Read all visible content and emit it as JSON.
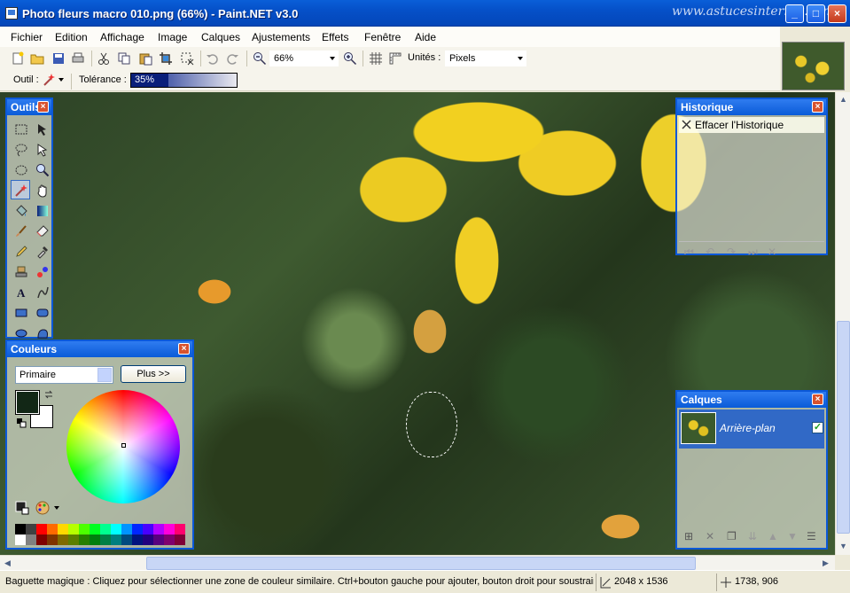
{
  "window": {
    "title": "Photo fleurs macro 010.png (66%) - Paint.NET v3.0",
    "watermark": "www.astucesinternet.com"
  },
  "menu": [
    "Fichier",
    "Edition",
    "Affichage",
    "Image",
    "Calques",
    "Ajustements",
    "Effets",
    "Fenêtre",
    "Aide"
  ],
  "toolbar": {
    "zoom_value": "66%",
    "units_label": "Unités :",
    "units_value": "Pixels"
  },
  "tool_options": {
    "tool_label": "Outil :",
    "tolerance_label": "Tolérance :",
    "tolerance_value": "35%",
    "tolerance_level": 0.35
  },
  "tools_panel": {
    "title": "Outils",
    "selected": "magic-wand"
  },
  "history_panel": {
    "title": "Historique",
    "items": [
      "Effacer l'Historique"
    ]
  },
  "layers_panel": {
    "title": "Calques",
    "layers": [
      {
        "name": "Arrière-plan",
        "visible": true
      }
    ]
  },
  "colors_panel": {
    "title": "Couleurs",
    "mode": "Primaire",
    "more_button": "Plus >>",
    "primary_color": "#122716",
    "secondary_color": "#ffffff"
  },
  "status": {
    "hint": "Baguette magique : Cliquez pour sélectionner une zone de couleur similaire. Ctrl+bouton gauche pour ajouter, bouton droit pour soustraire.",
    "image_size": "2048 x 1536",
    "cursor_pos": "1738, 906"
  },
  "colors": {
    "title_bar": "#0550c8",
    "panel_border": "#0b58d8",
    "selection_fill": "#3169c6"
  },
  "palette": [
    "#000000",
    "#404040",
    "#ff0000",
    "#ff6a00",
    "#ffd800",
    "#b6ff00",
    "#4cff00",
    "#00ff21",
    "#00ff90",
    "#00ffff",
    "#0094ff",
    "#0026ff",
    "#4800ff",
    "#b200ff",
    "#ff00dc",
    "#ff006e",
    "#ffffff",
    "#808080",
    "#7f0000",
    "#7f3300",
    "#7f6a00",
    "#5b7f00",
    "#267f00",
    "#007f0e",
    "#007f46",
    "#007f7f",
    "#004a7f",
    "#00137f",
    "#21007f",
    "#57007f",
    "#7f006e",
    "#7f0037"
  ]
}
